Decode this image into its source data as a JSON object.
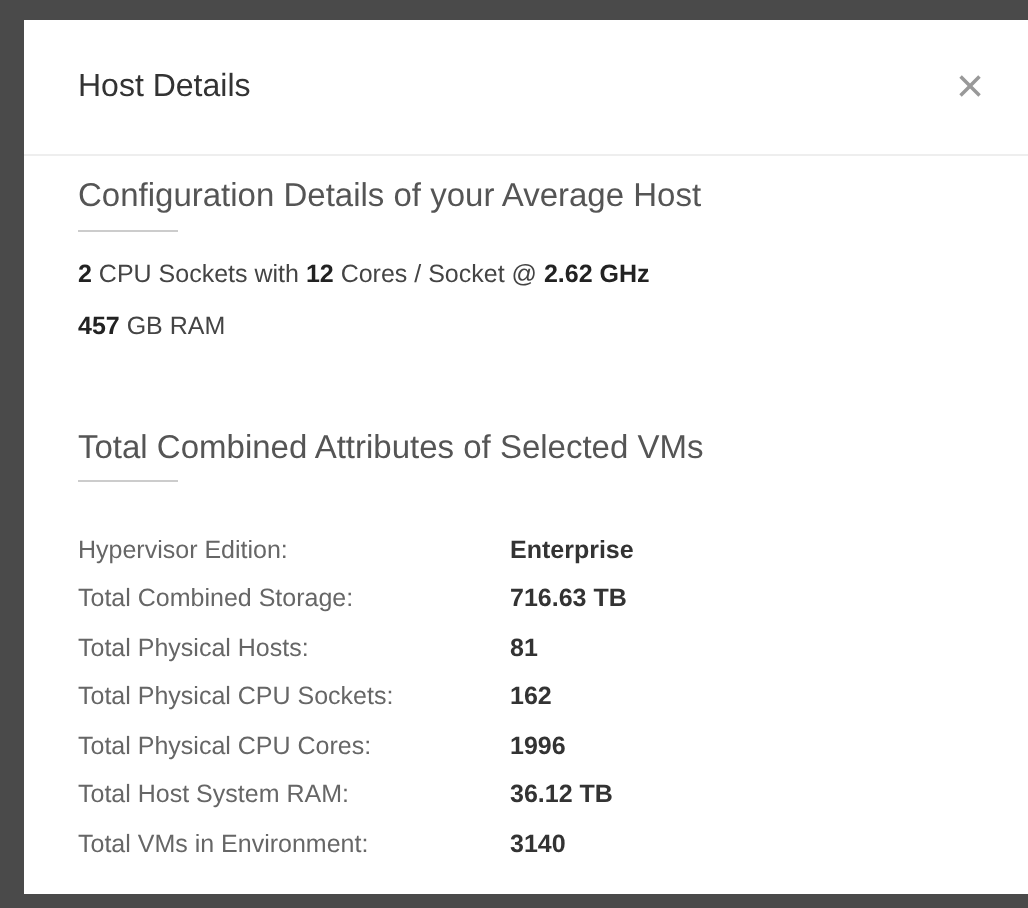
{
  "dialog": {
    "title": "Host Details",
    "close": "×"
  },
  "configuration": {
    "heading": "Configuration Details of your Average Host",
    "lines": [
      "**2** CPU Sockets with **12** Cores / Socket @ **2.62 GHz**",
      "**457** GB RAM"
    ]
  },
  "attributes": {
    "heading": "Total Combined Attributes of Selected VMs",
    "rows": [
      {
        "label": "Hypervisor Edition:",
        "value": "Enterprise"
      },
      {
        "label": "Total Combined Storage:",
        "value": "716.63 TB"
      },
      {
        "label": "Total Physical Hosts:",
        "value": "81"
      },
      {
        "label": "Total Physical CPU Sockets:",
        "value": "162"
      },
      {
        "label": "Total Physical CPU Cores:",
        "value": "1996"
      },
      {
        "label": "Total Host System RAM:",
        "value": "36.12 TB"
      },
      {
        "label": "Total VMs in Environment:",
        "value": "3140"
      }
    ]
  }
}
